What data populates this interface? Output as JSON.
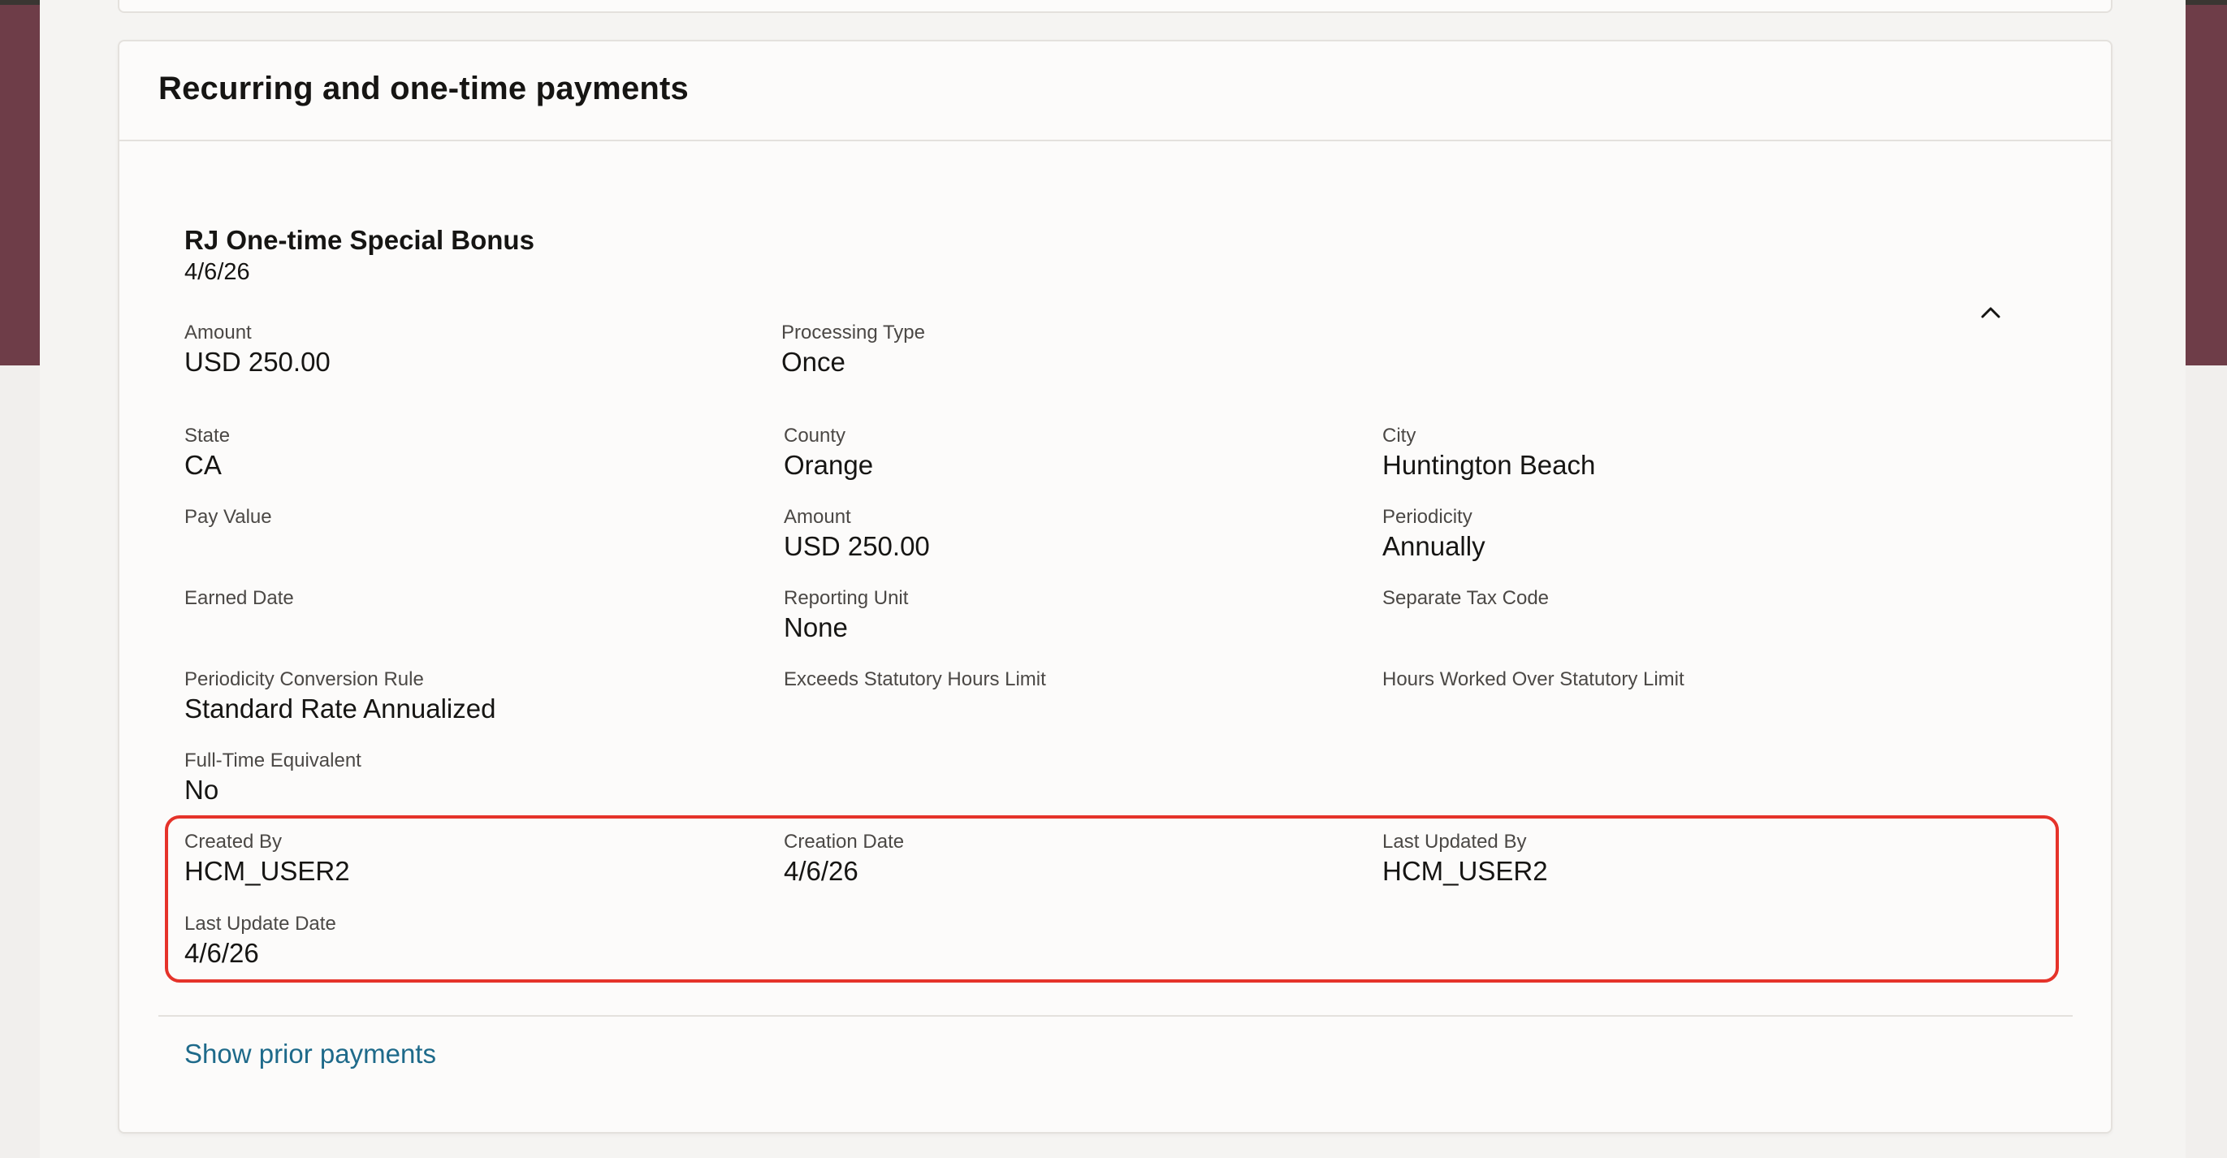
{
  "section": {
    "title": "Recurring and one-time payments"
  },
  "payment": {
    "title": "RJ One-time Special Bonus",
    "date": "4/6/26",
    "collapse_icon": "chevron-up-icon",
    "amount": {
      "label": "Amount",
      "value": "USD 250.00"
    },
    "processing_type": {
      "label": "Processing Type",
      "value": "Once"
    },
    "state": {
      "label": "State",
      "value": "CA"
    },
    "county": {
      "label": "County",
      "value": "Orange"
    },
    "city": {
      "label": "City",
      "value": "Huntington Beach"
    },
    "pay_value": {
      "label": "Pay Value",
      "value": ""
    },
    "amount2": {
      "label": "Amount",
      "value": "USD 250.00"
    },
    "periodicity": {
      "label": "Periodicity",
      "value": "Annually"
    },
    "earned_date": {
      "label": "Earned Date",
      "value": ""
    },
    "reporting_unit": {
      "label": "Reporting Unit",
      "value": "None"
    },
    "separate_tax_code": {
      "label": "Separate Tax Code",
      "value": ""
    },
    "periodicity_conversion_rule": {
      "label": "Periodicity Conversion Rule",
      "value": "Standard Rate Annualized"
    },
    "exceeds_statutory_hours_limit": {
      "label": "Exceeds Statutory Hours Limit",
      "value": ""
    },
    "hours_worked_over_statutory_limit": {
      "label": "Hours Worked Over Statutory Limit",
      "value": ""
    },
    "full_time_equivalent": {
      "label": "Full-Time Equivalent",
      "value": "No"
    },
    "created_by": {
      "label": "Created By",
      "value": "HCM_USER2"
    },
    "creation_date": {
      "label": "Creation Date",
      "value": "4/6/26"
    },
    "last_updated_by": {
      "label": "Last Updated By",
      "value": "HCM_USER2"
    },
    "last_update_date": {
      "label": "Last Update Date",
      "value": "4/6/26"
    }
  },
  "footer": {
    "show_prior_payments": "Show prior payments"
  },
  "colors": {
    "banner": "#6e3d48",
    "link": "#1e6a8a",
    "highlight": "#e5332a"
  }
}
